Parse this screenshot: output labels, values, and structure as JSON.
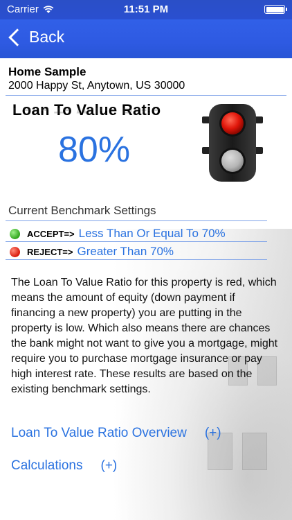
{
  "status_bar": {
    "carrier": "Carrier",
    "time": "11:51 PM",
    "battery_level": 1.0
  },
  "nav": {
    "back_label": "Back"
  },
  "property": {
    "name": "Home Sample",
    "address": "2000 Happy St, Anytown, US 30000"
  },
  "ratio": {
    "title": "Loan To Value Ratio",
    "value": "80%",
    "status": "red"
  },
  "benchmark": {
    "title": "Current Benchmark Settings",
    "accept_key": "ACCEPT=>",
    "accept_value": "Less Than Or Equal To 70%",
    "reject_key": "REJECT=>",
    "reject_value": "Greater Than 70%"
  },
  "description": "The Loan To Value Ratio for this property is red, which means the amount of equity (down payment if financing a new property) you are putting in the property is low.  Which also means  there are chances the bank might not want to give you a mortgage, might require you to purchase mortgage insurance or pay high interest rate. These results are based on the existing benchmark settings.",
  "sections": {
    "overview_label": "Loan To Value Ratio Overview",
    "overview_toggle": "(+)",
    "calculations_label": "Calculations",
    "calculations_toggle": "(+)"
  },
  "colors": {
    "accent": "#2a72e0",
    "nav": "#3160e8",
    "red_light": "#e0160a"
  }
}
